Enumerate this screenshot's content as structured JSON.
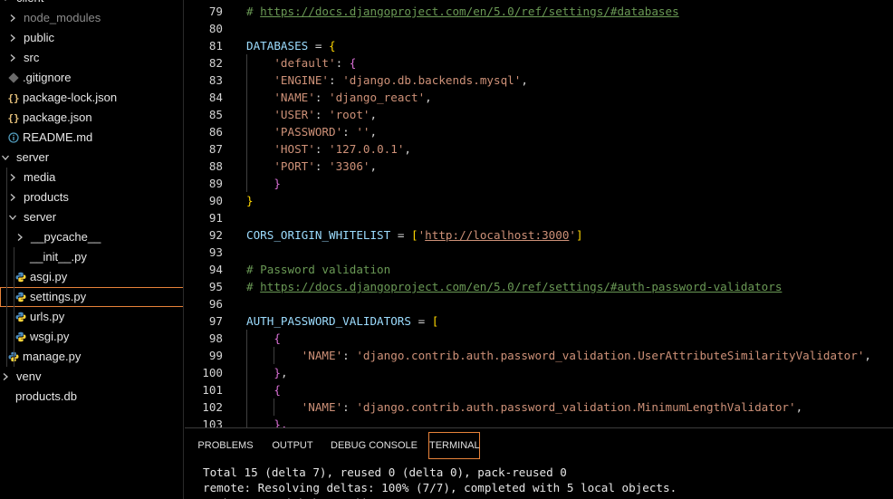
{
  "explorer": {
    "items": [
      {
        "label": "client",
        "type": "folder-open",
        "depth": 0,
        "icon": "chevron-down-icon"
      },
      {
        "label": "node_modules",
        "type": "folder",
        "depth": 1,
        "dim": true
      },
      {
        "label": "public",
        "type": "folder",
        "depth": 1
      },
      {
        "label": "src",
        "type": "folder",
        "depth": 1
      },
      {
        "label": ".gitignore",
        "type": "file",
        "depth": 1,
        "icon": "git-icon",
        "color": "#6b6b6b"
      },
      {
        "label": "package-lock.json",
        "type": "file",
        "depth": 1,
        "icon": "json-icon",
        "color": "#e5c07b"
      },
      {
        "label": "package.json",
        "type": "file",
        "depth": 1,
        "icon": "json-icon",
        "color": "#e5c07b"
      },
      {
        "label": "README.md",
        "type": "file",
        "depth": 1,
        "icon": "info-icon",
        "color": "#519aba"
      },
      {
        "label": "server",
        "type": "folder-open",
        "depth": 0
      },
      {
        "label": "media",
        "type": "folder",
        "depth": 1
      },
      {
        "label": "products",
        "type": "folder",
        "depth": 1
      },
      {
        "label": "server",
        "type": "folder-open",
        "depth": 1
      },
      {
        "label": "__pycache__",
        "type": "folder",
        "depth": 2
      },
      {
        "label": "__init__.py",
        "type": "file",
        "depth": 2,
        "icon": "none"
      },
      {
        "label": "asgi.py",
        "type": "file",
        "depth": 2,
        "icon": "python-icon",
        "color": "#4b8bbe"
      },
      {
        "label": "settings.py",
        "type": "file",
        "depth": 2,
        "icon": "python-icon",
        "color": "#4b8bbe",
        "selected": true
      },
      {
        "label": "urls.py",
        "type": "file",
        "depth": 2,
        "icon": "python-icon",
        "color": "#4b8bbe"
      },
      {
        "label": "wsgi.py",
        "type": "file",
        "depth": 2,
        "icon": "python-icon",
        "color": "#4b8bbe"
      },
      {
        "label": "manage.py",
        "type": "file",
        "depth": 1,
        "icon": "python-icon",
        "color": "#4b8bbe"
      },
      {
        "label": "venv",
        "type": "folder",
        "depth": 0
      },
      {
        "label": "products.db",
        "type": "file",
        "depth": 0,
        "icon": "none"
      }
    ]
  },
  "editor": {
    "lines": [
      {
        "n": "79",
        "tokens": [
          [
            "comment",
            "# "
          ],
          [
            "link",
            "https://docs.djangoproject.com/en/5.0/ref/settings/#databases"
          ]
        ]
      },
      {
        "n": "80",
        "tokens": []
      },
      {
        "n": "81",
        "tokens": [
          [
            "var",
            "DATABASES"
          ],
          [
            "op",
            " = "
          ],
          [
            "b1",
            "{"
          ]
        ]
      },
      {
        "n": "82",
        "indent": 1,
        "tokens": [
          [
            "str",
            "'default'"
          ],
          [
            "op",
            ": "
          ],
          [
            "b2",
            "{"
          ]
        ]
      },
      {
        "n": "83",
        "indent": 1,
        "tokens": [
          [
            "str",
            "'ENGINE'"
          ],
          [
            "op",
            ": "
          ],
          [
            "str",
            "'django.db.backends.mysql'"
          ],
          [
            "op",
            ","
          ]
        ]
      },
      {
        "n": "84",
        "indent": 1,
        "tokens": [
          [
            "str",
            "'NAME'"
          ],
          [
            "op",
            ": "
          ],
          [
            "str",
            "'django_react'"
          ],
          [
            "op",
            ","
          ]
        ]
      },
      {
        "n": "85",
        "indent": 1,
        "tokens": [
          [
            "str",
            "'USER'"
          ],
          [
            "op",
            ": "
          ],
          [
            "str",
            "'root'"
          ],
          [
            "op",
            ","
          ]
        ]
      },
      {
        "n": "86",
        "indent": 1,
        "tokens": [
          [
            "str",
            "'PASSWORD'"
          ],
          [
            "op",
            ": "
          ],
          [
            "str",
            "''"
          ],
          [
            "op",
            ","
          ]
        ]
      },
      {
        "n": "87",
        "indent": 1,
        "tokens": [
          [
            "str",
            "'HOST'"
          ],
          [
            "op",
            ": "
          ],
          [
            "str",
            "'127.0.0.1'"
          ],
          [
            "op",
            ","
          ]
        ]
      },
      {
        "n": "88",
        "indent": 1,
        "tokens": [
          [
            "str",
            "'PORT'"
          ],
          [
            "op",
            ": "
          ],
          [
            "str",
            "'3306'"
          ],
          [
            "op",
            ","
          ]
        ]
      },
      {
        "n": "89",
        "indent": 1,
        "tokens": [
          [
            "b2",
            "}"
          ]
        ]
      },
      {
        "n": "90",
        "tokens": [
          [
            "b1",
            "}"
          ]
        ]
      },
      {
        "n": "91",
        "tokens": []
      },
      {
        "n": "92",
        "tokens": [
          [
            "var",
            "CORS_ORIGIN_WHITELIST"
          ],
          [
            "op",
            " = "
          ],
          [
            "b1",
            "["
          ],
          [
            "str",
            "'"
          ],
          [
            "strlink",
            "http://localhost:3000"
          ],
          [
            "str",
            "'"
          ],
          [
            "b1",
            "]"
          ]
        ]
      },
      {
        "n": "93",
        "tokens": []
      },
      {
        "n": "94",
        "tokens": [
          [
            "comment",
            "# Password validation"
          ]
        ]
      },
      {
        "n": "95",
        "tokens": [
          [
            "comment",
            "# "
          ],
          [
            "link",
            "https://docs.djangoproject.com/en/5.0/ref/settings/#auth-password-validators"
          ]
        ]
      },
      {
        "n": "96",
        "tokens": []
      },
      {
        "n": "97",
        "tokens": [
          [
            "var",
            "AUTH_PASSWORD_VALIDATORS"
          ],
          [
            "op",
            " = "
          ],
          [
            "b1",
            "["
          ]
        ]
      },
      {
        "n": "98",
        "indent": 1,
        "tokens": [
          [
            "b2",
            "{"
          ]
        ]
      },
      {
        "n": "99",
        "indent": 2,
        "tokens": [
          [
            "str",
            "'NAME'"
          ],
          [
            "op",
            ": "
          ],
          [
            "str",
            "'django.contrib.auth.password_validation.UserAttributeSimilarityValidator'"
          ],
          [
            "op",
            ","
          ]
        ]
      },
      {
        "n": "100",
        "indent": 1,
        "tokens": [
          [
            "b2",
            "}"
          ],
          [
            "op",
            ","
          ]
        ]
      },
      {
        "n": "101",
        "indent": 1,
        "tokens": [
          [
            "b2",
            "{"
          ]
        ]
      },
      {
        "n": "102",
        "indent": 2,
        "tokens": [
          [
            "str",
            "'NAME'"
          ],
          [
            "op",
            ": "
          ],
          [
            "str",
            "'django.contrib.auth.password_validation.MinimumLengthValidator'"
          ],
          [
            "op",
            ","
          ]
        ]
      },
      {
        "n": "103",
        "indent": 1,
        "tokens": [
          [
            "b2",
            "},"
          ]
        ]
      }
    ]
  },
  "panel": {
    "tabs": [
      {
        "label": "PROBLEMS",
        "active": false
      },
      {
        "label": "OUTPUT",
        "active": false
      },
      {
        "label": "DEBUG CONSOLE",
        "active": false
      },
      {
        "label": "TERMINAL",
        "active": true
      }
    ],
    "terminal": [
      "Total 15 (delta 7), reused 0 (delta 0), pack-reused 0",
      "remote: Resolving deltas: 100% (7/7), completed with 5 local objects.",
      "To https://github.com/jiawen..."
    ]
  }
}
